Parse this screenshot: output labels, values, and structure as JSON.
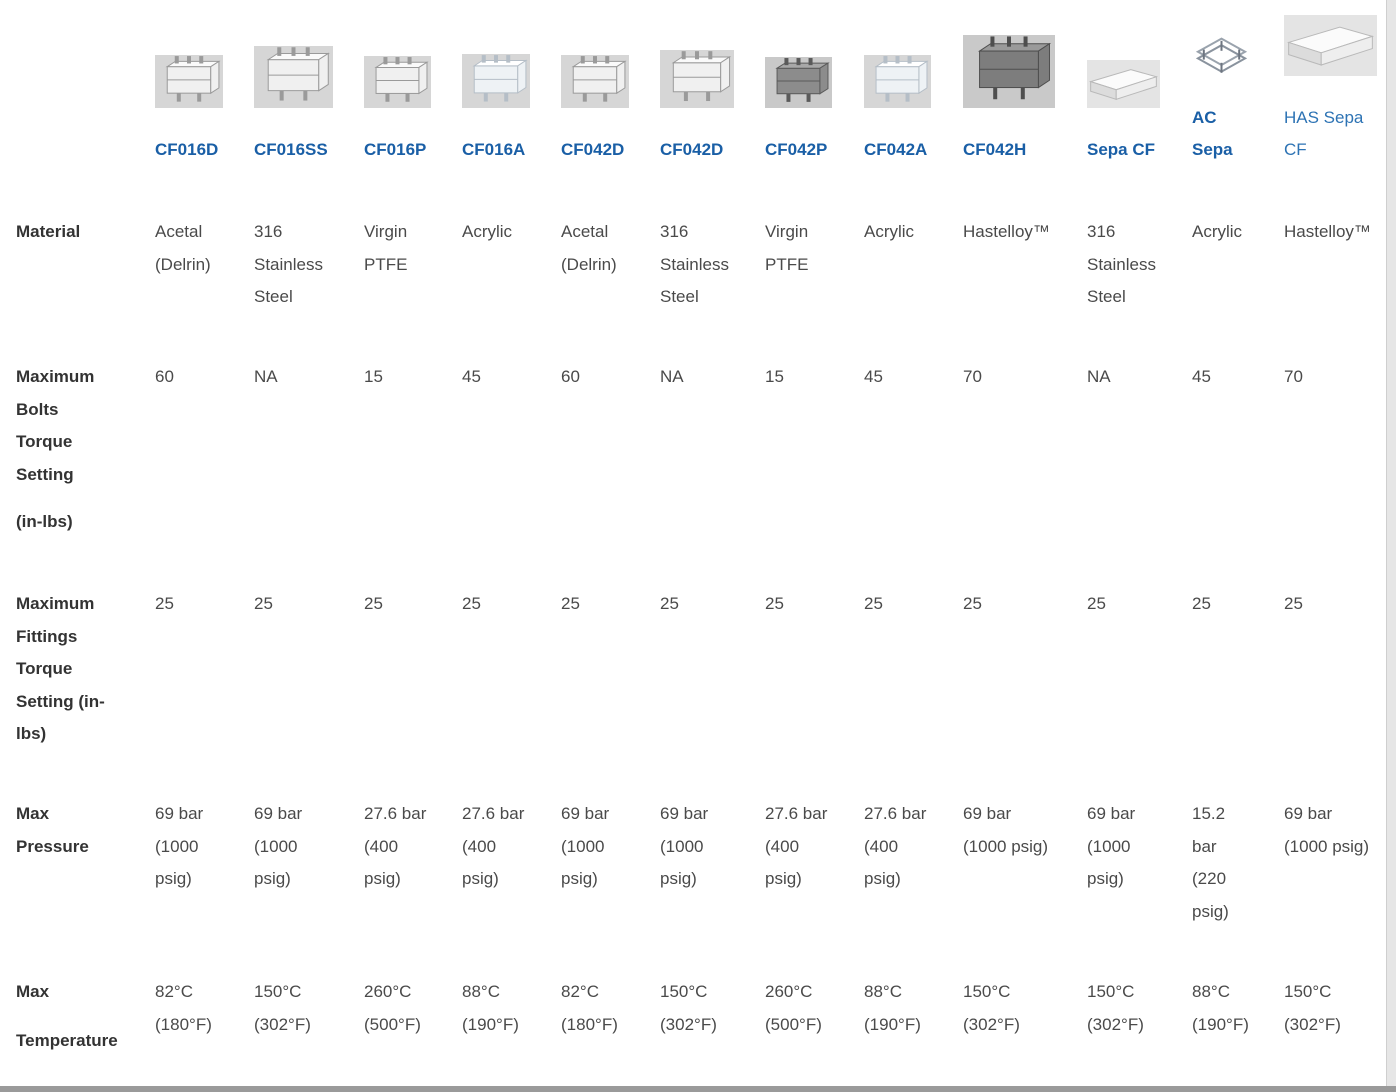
{
  "products": [
    {
      "name": [
        "CF016D"
      ],
      "thumb": "cell-cf016d-image",
      "material": [
        "Acetal",
        "(Delrin)"
      ],
      "bolts": "60",
      "fittings": "25",
      "pressure": [
        "69 bar",
        "(1000",
        "psig)"
      ],
      "temperature": [
        "82°C",
        "(180°F)"
      ]
    },
    {
      "name": [
        "CF016SS"
      ],
      "thumb": "cell-cf016ss-image",
      "material": [
        "316",
        "Stainless",
        "Steel"
      ],
      "bolts": "NA",
      "fittings": "25",
      "pressure": [
        "69 bar",
        "(1000",
        "psig)"
      ],
      "temperature": [
        "150°C",
        "(302°F)"
      ]
    },
    {
      "name": [
        "CF016P"
      ],
      "thumb": "cell-cf016p-image",
      "material": [
        "Virgin",
        "PTFE"
      ],
      "bolts": "15",
      "fittings": "25",
      "pressure": [
        "27.6 bar",
        "(400",
        "psig)"
      ],
      "temperature": [
        "260°C",
        "(500°F)"
      ]
    },
    {
      "name": [
        "CF016A"
      ],
      "thumb": "cell-cf016a-image",
      "material": [
        "Acrylic"
      ],
      "bolts": "45",
      "fittings": "25",
      "pressure": [
        "27.6 bar",
        "(400",
        "psig)"
      ],
      "temperature": [
        "88°C",
        "(190°F)"
      ]
    },
    {
      "name": [
        "CF042D"
      ],
      "thumb": "cell-cf042d-image",
      "material": [
        "Acetal",
        "(Delrin)"
      ],
      "bolts": "60",
      "fittings": "25",
      "pressure": [
        "69 bar",
        "(1000",
        "psig)"
      ],
      "temperature": [
        "82°C",
        "(180°F)"
      ]
    },
    {
      "name": [
        "CF042D"
      ],
      "thumb": "cell-cf042d-ss-image",
      "material": [
        "316",
        "Stainless",
        "Steel"
      ],
      "bolts": "NA",
      "fittings": "25",
      "pressure": [
        "69 bar",
        "(1000",
        "psig)"
      ],
      "temperature": [
        "150°C",
        "(302°F)"
      ]
    },
    {
      "name": [
        "CF042P"
      ],
      "thumb": "cell-cf042p-image",
      "material": [
        "Virgin",
        "PTFE"
      ],
      "bolts": "15",
      "fittings": "25",
      "pressure": [
        "27.6 bar",
        "(400",
        "psig)"
      ],
      "temperature": [
        "260°C",
        "(500°F)"
      ]
    },
    {
      "name": [
        "CF042A"
      ],
      "thumb": "cell-cf042a-image",
      "material": [
        "Acrylic"
      ],
      "bolts": "45",
      "fittings": "25",
      "pressure": [
        "27.6 bar",
        "(400",
        "psig)"
      ],
      "temperature": [
        "88°C",
        "(190°F)"
      ]
    },
    {
      "name": [
        "CF042H"
      ],
      "thumb": "cell-cf042h-image",
      "material": [
        "Hastelloy™"
      ],
      "bolts": "70",
      "fittings": "25",
      "pressure": [
        "69 bar",
        "(1000 psig)"
      ],
      "temperature": [
        "150°C",
        "(302°F)"
      ]
    },
    {
      "name": [
        "Sepa CF"
      ],
      "thumb": "cell-sepa-cf-image",
      "material": [
        "316",
        "Stainless",
        "Steel"
      ],
      "bolts": "NA",
      "fittings": "25",
      "pressure": [
        "69 bar",
        "(1000",
        "psig)"
      ],
      "temperature": [
        "150°C",
        "(302°F)"
      ]
    },
    {
      "name": [
        "AC",
        "Sepa"
      ],
      "thumb": "cell-ac-sepa-image",
      "material": [
        "Acrylic"
      ],
      "bolts": "45",
      "fittings": "25",
      "pressure": [
        "15.2",
        "bar",
        "(220",
        "psig)"
      ],
      "temperature": [
        "88°C",
        "(190°F)"
      ]
    },
    {
      "name": [
        "HAS Sepa",
        "CF"
      ],
      "thumb": "cell-has-sepa-image",
      "material": [
        "Hastelloy™"
      ],
      "bolts": "70",
      "fittings": "25",
      "pressure": [
        "69 bar",
        "(1000 psig)"
      ],
      "temperature": [
        "150°C",
        "(302°F)"
      ]
    }
  ],
  "row_labels": {
    "material": [
      "Material"
    ],
    "bolts": [
      "Maximum",
      "Bolts",
      "Torque",
      "Setting"
    ],
    "bolts_unit": "(in-lbs)",
    "fittings": [
      "Maximum",
      "Fittings",
      "Torque",
      "Setting (in-",
      "lbs)"
    ],
    "pressure": [
      "Max",
      "Pressure"
    ],
    "temperature_top": "Max",
    "temperature_bottom": "Temperature"
  }
}
